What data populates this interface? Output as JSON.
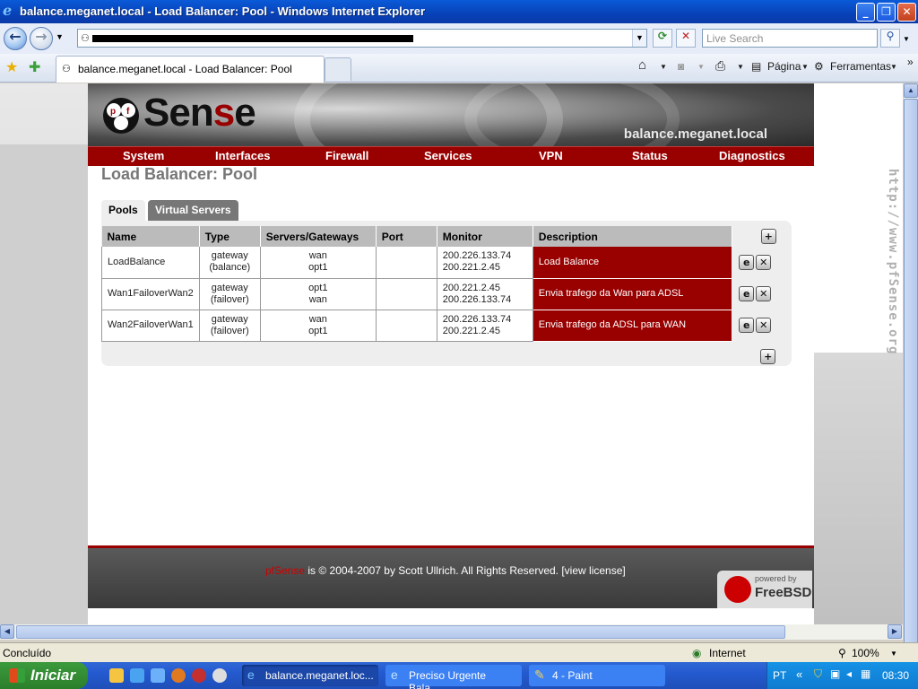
{
  "window": {
    "title": "balance.meganet.local - Load Balancer: Pool - Windows Internet Explorer",
    "minimize": "_",
    "maximize": "❐",
    "close": "✕"
  },
  "address_bar": {
    "search_placeholder": "Live Search"
  },
  "browser_tab": {
    "label": "balance.meganet.local - Load Balancer: Pool"
  },
  "toolbar": {
    "pagina": "Página",
    "ferramentas": "Ferramentas"
  },
  "header": {
    "logo_prefix": "Sen",
    "logo_accent": "s",
    "logo_suffix": "e",
    "hostname": "balance.meganet.local"
  },
  "menu": [
    "System",
    "Interfaces",
    "Firewall",
    "Services",
    "VPN",
    "Status",
    "Diagnostics"
  ],
  "page_title": "Load Balancer: Pool",
  "tabs": {
    "pools": "Pools",
    "virtual_servers": "Virtual Servers"
  },
  "table": {
    "headers": {
      "name": "Name",
      "type": "Type",
      "servers": "Servers/Gateways",
      "port": "Port",
      "monitor": "Monitor",
      "description": "Description"
    },
    "rows": [
      {
        "name": "LoadBalance",
        "type1": "gateway",
        "type2": "(balance)",
        "srv1": "wan",
        "srv2": "opt1",
        "port": "",
        "mon1": "200.226.133.74",
        "mon2": "200.221.2.45",
        "description": "Load Balance"
      },
      {
        "name": "Wan1FailoverWan2",
        "type1": "gateway",
        "type2": "(failover)",
        "srv1": "opt1",
        "srv2": "wan",
        "port": "",
        "mon1": "200.221.2.45",
        "mon2": "200.226.133.74",
        "description": "Envia trafego da Wan para ADSL"
      },
      {
        "name": "Wan2FailoverWan1",
        "type1": "gateway",
        "type2": "(failover)",
        "srv1": "wan",
        "srv2": "opt1",
        "port": "",
        "mon1": "200.226.133.74",
        "mon2": "200.221.2.45",
        "description": "Envia trafego da ADSL para WAN"
      }
    ]
  },
  "side_watermark": "http://www.pfSense.org",
  "footer": {
    "pf": "pfSense",
    "rest": " is © 2004-2007 by Scott Ullrich. All Rights Reserved. [view license]",
    "powered_by": "powered by",
    "freebsd": "FreeBSD"
  },
  "statusbar": {
    "status": "Concluído",
    "zone": "Internet",
    "zoom": "100%"
  },
  "taskbar": {
    "start": "Iniciar",
    "tasks": [
      "balance.meganet.loc...",
      "Preciso Urgente Bala...",
      "4 - Paint"
    ],
    "lang": "PT",
    "clock": "08:30"
  },
  "colors": {
    "pfsense_red": "#990000",
    "xp_blue": "#245ad0"
  }
}
